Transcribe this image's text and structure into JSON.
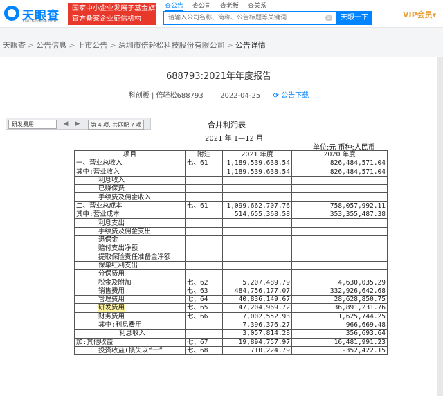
{
  "header": {
    "logo_name": "天眼查",
    "logo_sub": "TianYanCha.com",
    "promo_line1": "国家中小企业发展子基金旗下",
    "promo_line2": "官方备案企业征信机构",
    "tabs": [
      "查公告",
      "查公司",
      "查老板",
      "查关系"
    ],
    "search_placeholder": "请输入公司名称、简称、公告标题等关键词",
    "search_button": "天眼一下",
    "vip_label": "VIP会员"
  },
  "breadcrumb": [
    "天眼查",
    "公告信息",
    "上市公告",
    "深圳市倍轻松科技股份有限公司",
    "公告详情"
  ],
  "document": {
    "title": "688793:2021年年度报告",
    "board": "科创板 | 倍轻松688793",
    "date": "2022-04-25",
    "download_label": "公告下载"
  },
  "viewer_toolbar": {
    "search_term": "研发费用",
    "match_info": "第 4 项, 共匹配 7 项"
  },
  "statement": {
    "title": "合并利润表",
    "period": "2021 年 1—12 月",
    "unit": "单位:元   币种:人民币",
    "headers": [
      "项目",
      "附注",
      "2021 年度",
      "2020 年度"
    ],
    "rows": [
      {
        "item": "一、营业总收入",
        "note": "七、61",
        "y2021": "1,189,539,638.54",
        "y2020": "826,484,571.04",
        "indent": 0
      },
      {
        "item": "其中:营业收入",
        "note": "",
        "y2021": "1,189,539,638.54",
        "y2020": "826,484,571.04",
        "indent": 0
      },
      {
        "item": "利息收入",
        "note": "",
        "y2021": "",
        "y2020": "",
        "indent": 1
      },
      {
        "item": "已赚保费",
        "note": "",
        "y2021": "",
        "y2020": "",
        "indent": 1
      },
      {
        "item": "手续费及佣金收入",
        "note": "",
        "y2021": "",
        "y2020": "",
        "indent": 1
      },
      {
        "item": "二、营业总成本",
        "note": "七、61",
        "y2021": "1,099,662,707.76",
        "y2020": "758,057,992.11",
        "indent": 0
      },
      {
        "item": "其中:营业成本",
        "note": "",
        "y2021": "514,655,368.58",
        "y2020": "353,355,487.38",
        "indent": 0
      },
      {
        "item": "利息支出",
        "note": "",
        "y2021": "",
        "y2020": "",
        "indent": 1
      },
      {
        "item": "手续费及佣金支出",
        "note": "",
        "y2021": "",
        "y2020": "",
        "indent": 1
      },
      {
        "item": "退保金",
        "note": "",
        "y2021": "",
        "y2020": "",
        "indent": 1
      },
      {
        "item": "赔付支出净额",
        "note": "",
        "y2021": "",
        "y2020": "",
        "indent": 1
      },
      {
        "item": "提取保险责任准备金净额",
        "note": "",
        "y2021": "",
        "y2020": "",
        "indent": 1
      },
      {
        "item": "保单红利支出",
        "note": "",
        "y2021": "",
        "y2020": "",
        "indent": 1
      },
      {
        "item": "分保费用",
        "note": "",
        "y2021": "",
        "y2020": "",
        "indent": 1
      },
      {
        "item": "税金及附加",
        "note": "七、62",
        "y2021": "5,207,489.79",
        "y2020": "4,630,035.29",
        "indent": 1
      },
      {
        "item": "销售费用",
        "note": "七、63",
        "y2021": "484,756,177.07",
        "y2020": "332,926,642.68",
        "indent": 1
      },
      {
        "item": "管理费用",
        "note": "七、64",
        "y2021": "40,836,149.67",
        "y2020": "28,628,850.75",
        "indent": 1
      },
      {
        "item": "研发费用",
        "note": "七、65",
        "y2021": "47,204,969.72",
        "y2020": "36,891,231.76",
        "indent": 1,
        "highlight": true
      },
      {
        "item": "财务费用",
        "note": "七、66",
        "y2021": "7,002,552.93",
        "y2020": "1,625,744.25",
        "indent": 1
      },
      {
        "item": "其中:利息费用",
        "note": "",
        "y2021": "7,396,376.27",
        "y2020": "966,669.48",
        "indent": 1
      },
      {
        "item": "利息收入",
        "note": "",
        "y2021": "3,057,814.28",
        "y2020": "356,693.64",
        "indent": 2
      },
      {
        "item": "加:其他收益",
        "note": "七、67",
        "y2021": "19,894,757.97",
        "y2020": "16,481,991.23",
        "indent": 0
      },
      {
        "item": "投资收益(损失以“一”",
        "note": "七、68",
        "y2021": "710,224.79",
        "y2020": "-352,422.15",
        "indent": 1
      }
    ]
  }
}
